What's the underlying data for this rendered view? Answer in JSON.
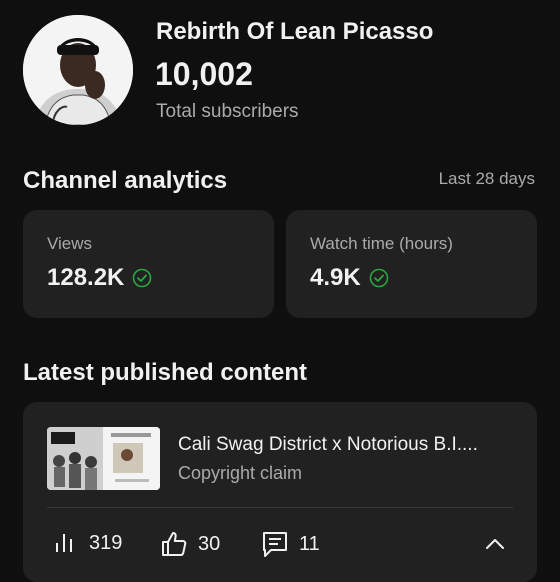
{
  "channel": {
    "name": "Rebirth Of Lean Picasso",
    "subscribers": "10,002",
    "subscribers_label": "Total subscribers"
  },
  "analytics": {
    "title": "Channel analytics",
    "range": "Last 28 days",
    "cards": [
      {
        "label": "Views",
        "value": "128.2K",
        "icon": "check-circle-icon"
      },
      {
        "label": "Watch time (hours)",
        "value": "4.9K",
        "icon": "check-circle-icon"
      }
    ]
  },
  "latest": {
    "title": "Latest published content",
    "video": {
      "title": "Cali Swag District x Notorious B.I....",
      "status": "Copyright claim",
      "stats": {
        "views": "319",
        "likes": "30",
        "comments": "11"
      }
    }
  },
  "colors": {
    "background": "#0f0f0f",
    "card": "#212121",
    "accent_green": "#2ba640",
    "secondary_text": "#aaaaaa"
  }
}
